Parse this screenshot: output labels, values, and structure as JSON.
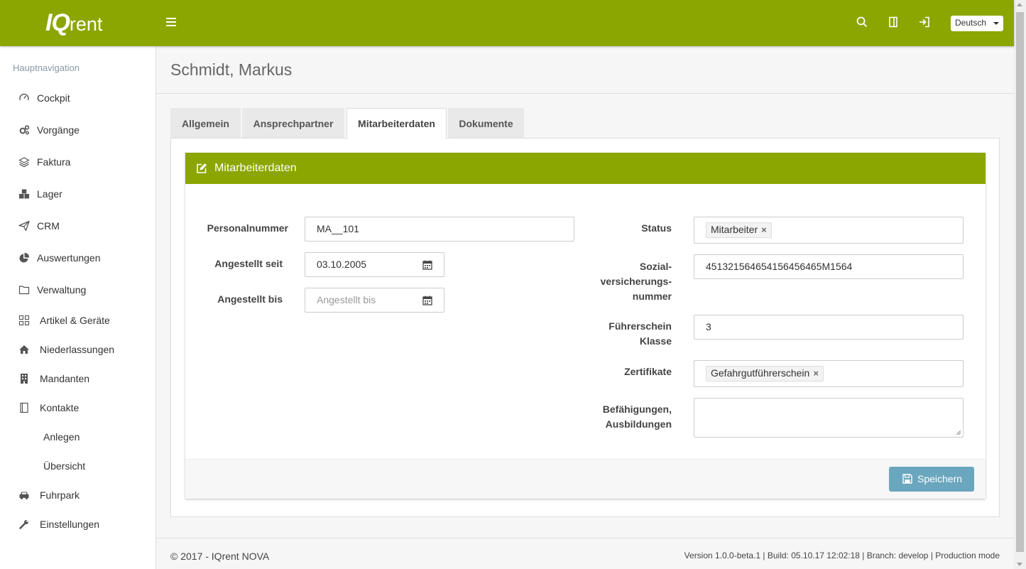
{
  "header": {
    "logo_main": "IQ",
    "logo_sub": "rent",
    "language": "Deutsch",
    "icons": [
      "search-icon",
      "columns-icon",
      "logout-icon"
    ]
  },
  "sidebar": {
    "heading": "Hauptnavigation",
    "items": [
      {
        "label": "Cockpit",
        "icon": "dashboard-icon"
      },
      {
        "label": "Vorgänge",
        "icon": "cogs-icon"
      },
      {
        "label": "Faktura",
        "icon": "layers-icon"
      },
      {
        "label": "Lager",
        "icon": "cubes-icon"
      },
      {
        "label": "CRM",
        "icon": "paper-plane-icon"
      },
      {
        "label": "Auswertungen",
        "icon": "pie-chart-icon"
      },
      {
        "label": "Verwaltung",
        "icon": "folder-icon"
      },
      {
        "label": "Artikel & Geräte",
        "icon": "grid-icon"
      },
      {
        "label": "Niederlassungen",
        "icon": "home-icon"
      },
      {
        "label": "Mandanten",
        "icon": "building-icon"
      },
      {
        "label": "Kontakte",
        "icon": "address-book-icon"
      },
      {
        "label": "Anlegen",
        "icon": ""
      },
      {
        "label": "Übersicht",
        "icon": ""
      },
      {
        "label": "Fuhrpark",
        "icon": "car-icon"
      },
      {
        "label": "Einstellungen",
        "icon": "wrench-icon"
      }
    ]
  },
  "page": {
    "title": "Schmidt, Markus",
    "tabs": [
      {
        "label": "Allgemein"
      },
      {
        "label": "Ansprechpartner"
      },
      {
        "label": "Mitarbeiterdaten"
      },
      {
        "label": "Dokumente"
      }
    ],
    "active_tab": "Mitarbeiterdaten"
  },
  "form": {
    "title": "Mitarbeiterdaten",
    "personalnummer_label": "Personalnummer",
    "personalnummer_value": "MA__101",
    "angestellt_seit_label": "Angestellt seit",
    "angestellt_seit_value": "03.10.2005",
    "angestellt_bis_label": "Angestellt bis",
    "angestellt_bis_placeholder": "Angestellt bis",
    "status_label": "Status",
    "status_tag": "Mitarbeiter",
    "sv_label_1": "Sozial-",
    "sv_label_2": "versicherungs-",
    "sv_label_3": "nummer",
    "sv_value": "451321564654156456465M1564",
    "fs_label_1": "Führerschein",
    "fs_label_2": "Klasse",
    "fs_value": "3",
    "zertifikate_label": "Zertifikate",
    "zertifikate_tag": "Gefahrgutführerschein",
    "bef_label_1": "Befähigungen,",
    "bef_label_2": "Ausbildungen",
    "bef_value": "",
    "tag_remove": "×",
    "save_label": "Speichern"
  },
  "footer": {
    "copyright": "© 2017 - IQrent NOVA",
    "version": "Version 1.0.0-beta.1 | Build: 05.10.17 12:02:18 | Branch: develop | Production mode"
  },
  "colors": {
    "brand": "#8ba600",
    "save_button": "#6aa6be"
  }
}
